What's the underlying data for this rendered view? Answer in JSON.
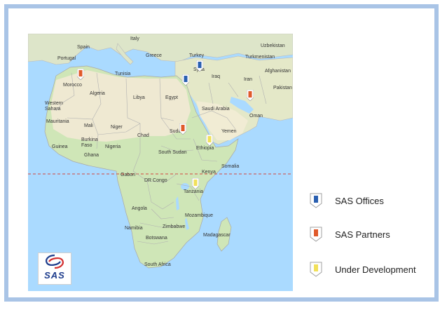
{
  "legend": {
    "items": [
      {
        "label": "SAS Offices",
        "color": "#2a5fb0"
      },
      {
        "label": "SAS Partners",
        "color": "#e05a2b"
      },
      {
        "label": "Under Development",
        "color": "#f1e05a"
      }
    ]
  },
  "map": {
    "labels": [
      {
        "text": "Spain"
      },
      {
        "text": "Italy"
      },
      {
        "text": "Portugal"
      },
      {
        "text": "Greece"
      },
      {
        "text": "Turkey"
      },
      {
        "text": "Uzbekistan"
      },
      {
        "text": "Turkmenistan"
      },
      {
        "text": "Tunisia"
      },
      {
        "text": "Syria"
      },
      {
        "text": "Afghanistan"
      },
      {
        "text": "Morocco"
      },
      {
        "text": "Iraq"
      },
      {
        "text": "Iran"
      },
      {
        "text": "Pakistan"
      },
      {
        "text": "Algeria"
      },
      {
        "text": "Libya"
      },
      {
        "text": "Egypt"
      },
      {
        "text": "Western Sahara"
      },
      {
        "text": "Saudi Arabia"
      },
      {
        "text": "Oman"
      },
      {
        "text": "Mauritania"
      },
      {
        "text": "Mali"
      },
      {
        "text": "Niger"
      },
      {
        "text": "Chad"
      },
      {
        "text": "Sudan"
      },
      {
        "text": "Yemen"
      },
      {
        "text": "Burkina Faso"
      },
      {
        "text": "Guinea"
      },
      {
        "text": "Ghana"
      },
      {
        "text": "Nigeria"
      },
      {
        "text": "South Sudan"
      },
      {
        "text": "Ethiopia"
      },
      {
        "text": "Somalia"
      },
      {
        "text": "Gabon"
      },
      {
        "text": "DR Congo"
      },
      {
        "text": "Kenya"
      },
      {
        "text": "Tanzania"
      },
      {
        "text": "Angola"
      },
      {
        "text": "Mozambique"
      },
      {
        "text": "Namibia"
      },
      {
        "text": "Zimbabwe"
      },
      {
        "text": "Botswana"
      },
      {
        "text": "Madagascar"
      },
      {
        "text": "South Africa"
      }
    ],
    "markers": [
      {
        "name": "office-marker-turkey",
        "type": "office",
        "color": "#2a5fb0"
      },
      {
        "name": "office-marker-egypt",
        "type": "office",
        "color": "#2a5fb0"
      },
      {
        "name": "partner-marker-morocco",
        "type": "partner",
        "color": "#e05a2b"
      },
      {
        "name": "partner-marker-uae",
        "type": "partner",
        "color": "#e05a2b"
      },
      {
        "name": "partner-marker-sudan",
        "type": "partner",
        "color": "#e05a2b"
      },
      {
        "name": "development-marker-ethiopia",
        "type": "development",
        "color": "#f1e05a"
      },
      {
        "name": "development-marker-tanzania",
        "type": "development",
        "color": "#f1e05a"
      }
    ]
  },
  "logo": {
    "text": "SAS"
  }
}
